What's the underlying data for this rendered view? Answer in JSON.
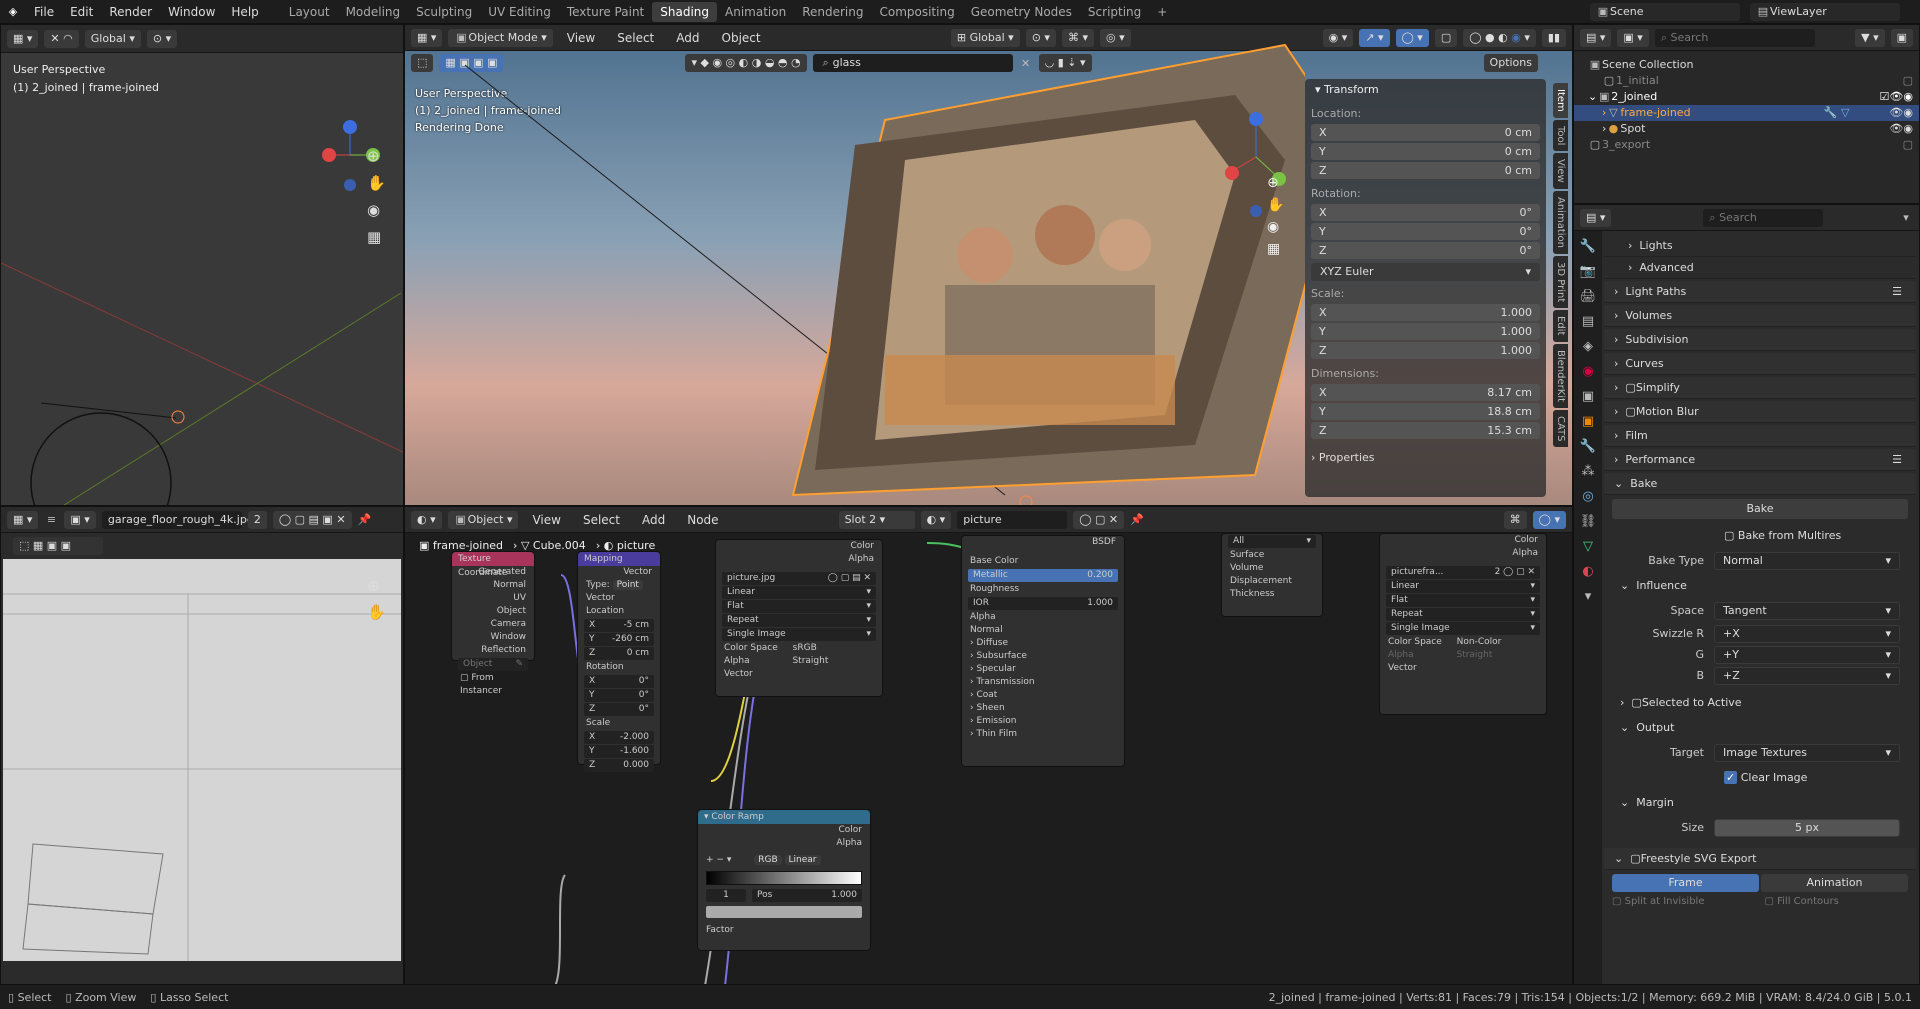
{
  "topbar": {
    "menus": [
      "File",
      "Edit",
      "Render",
      "Window",
      "Help"
    ],
    "workspaces": [
      "Layout",
      "Modeling",
      "Sculpting",
      "UV Editing",
      "Texture Paint",
      "Shading",
      "Animation",
      "Rendering",
      "Compositing",
      "Geometry Nodes",
      "Scripting"
    ],
    "active": "Shading",
    "scene": "Scene",
    "viewlayer": "ViewLayer",
    "plus": "+"
  },
  "left_viewport": {
    "transform": "Global",
    "perspective": "User Perspective",
    "object": "(1) 2_joined | frame-joined"
  },
  "main_viewport": {
    "mode": "Object Mode",
    "menus": [
      "View",
      "Select",
      "Add",
      "Object"
    ],
    "transform": "Global",
    "search": "glass",
    "options": "Options",
    "perspective": "User Perspective",
    "object": "(1) 2_joined | frame-joined",
    "status": "Rendering Done"
  },
  "npanel": {
    "title": "Transform",
    "location_label": "Location:",
    "location": [
      {
        "axis": "X",
        "value": "0 cm"
      },
      {
        "axis": "Y",
        "value": "0 cm"
      },
      {
        "axis": "Z",
        "value": "0 cm"
      }
    ],
    "rotation_label": "Rotation:",
    "rotation": [
      {
        "axis": "X",
        "value": "0°"
      },
      {
        "axis": "Y",
        "value": "0°"
      },
      {
        "axis": "Z",
        "value": "0°"
      }
    ],
    "euler": "XYZ Euler",
    "scale_label": "Scale:",
    "scale": [
      {
        "axis": "X",
        "value": "1.000"
      },
      {
        "axis": "Y",
        "value": "1.000"
      },
      {
        "axis": "Z",
        "value": "1.000"
      }
    ],
    "dims_label": "Dimensions:",
    "dims": [
      {
        "axis": "X",
        "value": "8.17 cm"
      },
      {
        "axis": "Y",
        "value": "18.8 cm"
      },
      {
        "axis": "Z",
        "value": "15.3 cm"
      }
    ],
    "properties": "Properties",
    "tabs": [
      "Item",
      "Tool",
      "View",
      "Animation",
      "3D Print",
      "Edit",
      "BlenderKit",
      "CATS"
    ]
  },
  "image_editor": {
    "image": "garage_floor_rough_4k.jpg",
    "users": "2"
  },
  "node_editor": {
    "type": "Object",
    "menus": [
      "View",
      "Select",
      "Add",
      "Node"
    ],
    "slot": "Slot 2",
    "material": "picture",
    "breadcrumb": [
      "frame-joined",
      "Cube.004",
      "picture"
    ]
  },
  "nodes": {
    "texcoord": {
      "title": "Texture Coordinate",
      "outputs": [
        "Generated",
        "Normal",
        "UV",
        "Object",
        "Camera",
        "Window",
        "Reflection"
      ],
      "object": "Object",
      "instancer": "From Instancer"
    },
    "mapping": {
      "title": "Mapping",
      "out": "Vector",
      "type_label": "Type:",
      "type": "Point",
      "in": "Vector",
      "loc": "Location",
      "loc_vals": [
        {
          "a": "X",
          "v": "-5 cm"
        },
        {
          "a": "Y",
          "v": "-260 cm"
        },
        {
          "a": "Z",
          "v": "0 cm"
        }
      ],
      "rot": "Rotation",
      "rot_vals": [
        {
          "a": "X",
          "v": "0°"
        },
        {
          "a": "Y",
          "v": "0°"
        },
        {
          "a": "Z",
          "v": "0°"
        }
      ],
      "scale": "Scale",
      "scale_vals": [
        {
          "a": "X",
          "v": "-2.000"
        },
        {
          "a": "Y",
          "v": "-1.600"
        },
        {
          "a": "Z",
          "v": "0.000"
        }
      ]
    },
    "image": {
      "outputs": [
        "Color",
        "Alpha"
      ],
      "file": "picture.jpg",
      "opts": [
        "Linear",
        "Flat",
        "Repeat",
        "Single Image"
      ],
      "cs_label": "Color Space",
      "cs": "sRGB",
      "alpha_label": "Alpha",
      "alpha": "Straight",
      "in": "Vector"
    },
    "bsdf": {
      "title": "BSDF",
      "inputs": [
        "Base Color",
        "Metallic",
        "Roughness",
        "IOR",
        "Alpha",
        "Normal"
      ],
      "metallic": "0.200",
      "ior": "1.000",
      "subs": [
        "Diffuse",
        "Subsurface",
        "Specular",
        "Transmission",
        "Coat",
        "Sheen",
        "Emission",
        "Thin Film"
      ]
    },
    "output": {
      "target": "All",
      "inputs": [
        "Surface",
        "Volume",
        "Displacement",
        "Thickness"
      ]
    },
    "image2": {
      "outputs": [
        "Color",
        "Alpha"
      ],
      "file": "picturefra...",
      "users": "2",
      "opts": [
        "Linear",
        "Flat",
        "Repeat",
        "Single Image"
      ],
      "cs_label": "Color Space",
      "cs": "Non-Color",
      "alpha_label": "Alpha",
      "alpha": "Straight",
      "in": "Vector"
    },
    "ramp": {
      "title": "Color Ramp",
      "outputs": [
        "Color",
        "Alpha"
      ],
      "mode": "RGB",
      "interp": "Linear",
      "index": "1",
      "pos_label": "Pos",
      "pos": "1.000",
      "in": "Factor"
    }
  },
  "outliner": {
    "search": "Search",
    "root": "Scene Collection",
    "items": [
      "1_initial",
      "2_joined",
      "frame-joined",
      "Spot",
      "3_export"
    ]
  },
  "properties": {
    "search": "Search",
    "sections": [
      "Lights",
      "Advanced",
      "Light Paths",
      "Volumes",
      "Subdivision",
      "Curves",
      "Simplify",
      "Motion Blur",
      "Film",
      "Performance",
      "Bake"
    ],
    "bake_btn": "Bake",
    "multires": "Bake from Multires",
    "bake_type_label": "Bake Type",
    "bake_type": "Normal",
    "influence": "Influence",
    "space_label": "Space",
    "space": "Tangent",
    "swz": [
      {
        "l": "Swizzle R",
        "v": "+X"
      },
      {
        "l": "G",
        "v": "+Y"
      },
      {
        "l": "B",
        "v": "+Z"
      }
    ],
    "sel_active": "Selected to Active",
    "output": "Output",
    "target_label": "Target",
    "target": "Image Textures",
    "clear": "Clear Image",
    "margin": "Margin",
    "size_label": "Size",
    "size": "5 px",
    "freestyle": "Freestyle SVG Export",
    "frame": "Frame",
    "animation": "Animation",
    "split": "Split at Invisible",
    "fill": "Fill Contours"
  },
  "statusbar": {
    "left": [
      "Select",
      "Zoom View",
      "Lasso Select"
    ],
    "right": "2_joined | frame-joined | Verts:81 | Faces:79 | Tris:154 | Objects:1/2 | Memory: 669.2 MiB | VRAM: 8.4/24.0 GiB | 5.0.1"
  },
  "colors": {
    "accent": "#4772b3",
    "selected": "#ffaa40",
    "bg": "#1d1d1d"
  }
}
